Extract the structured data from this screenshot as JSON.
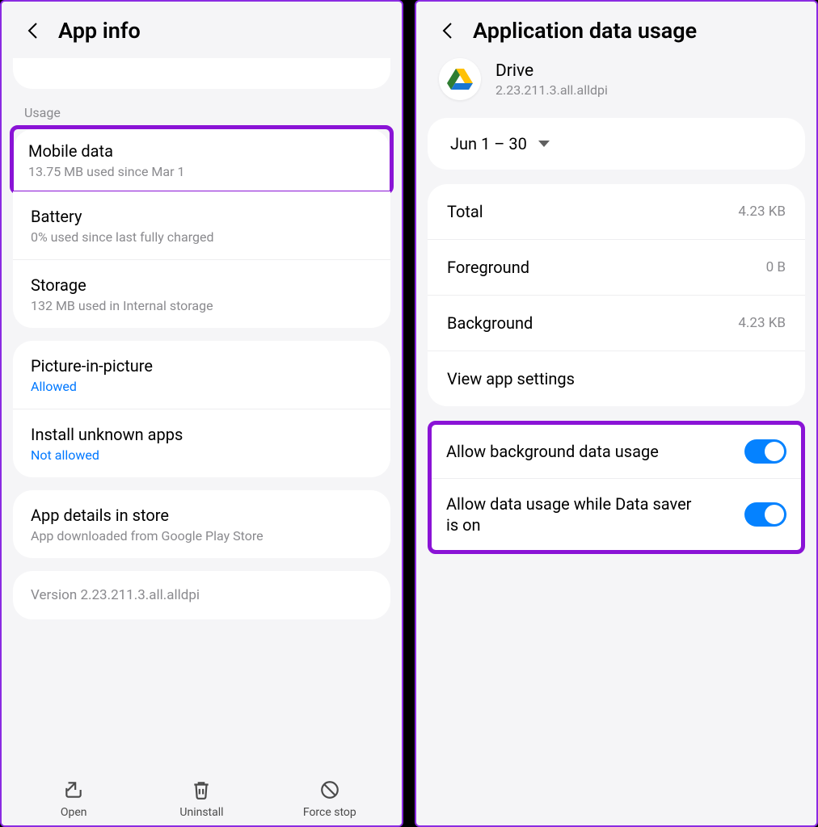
{
  "left": {
    "title": "App info",
    "usage_label": "Usage",
    "mobile_data": {
      "title": "Mobile data",
      "sub": "13.75 MB used since Mar 1"
    },
    "battery": {
      "title": "Battery",
      "sub": "0% used since last fully charged"
    },
    "storage": {
      "title": "Storage",
      "sub": "132 MB used in Internal storage"
    },
    "pip": {
      "title": "Picture-in-picture",
      "sub": "Allowed"
    },
    "unknown": {
      "title": "Install unknown apps",
      "sub": "Not allowed"
    },
    "details": {
      "title": "App details in store",
      "sub": "App downloaded from Google Play Store"
    },
    "version": "Version 2.23.211.3.all.alldpi",
    "btn_open": "Open",
    "btn_uninstall": "Uninstall",
    "btn_force": "Force stop"
  },
  "right": {
    "title": "Application data usage",
    "app_name": "Drive",
    "app_ver": "2.23.211.3.all.alldpi",
    "date_range": "Jun 1 – 30",
    "total": {
      "label": "Total",
      "value": "4.23 KB"
    },
    "fg": {
      "label": "Foreground",
      "value": "0 B"
    },
    "bg": {
      "label": "Background",
      "value": "4.23 KB"
    },
    "view_settings": "View app settings",
    "toggle_bg": "Allow background data usage",
    "toggle_saver": "Allow data usage while Data saver is on"
  }
}
